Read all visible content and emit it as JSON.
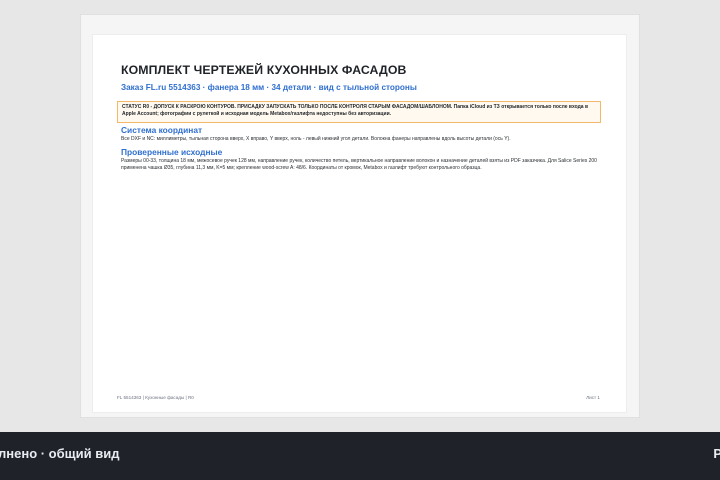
{
  "document": {
    "title": "КОМПЛЕКТ ЧЕРТЕЖЕЙ КУХОННЫХ ФАСАДОВ",
    "subtitle": "Заказ FL.ru 5514363 · фанера 18 мм · 34 детали · вид с тыльной стороны",
    "status_box_text": "СТАТУС R0 - ДОПУСК К РАСКРОЮ КОНТУРОВ. ПРИСАДКУ ЗАПУСКАТЬ ТОЛЬКО ПОСЛЕ КОНТРОЛЯ СТАРЫМ ФАСАДОМ/ШАБЛОНОМ. Папка iCloud из ТЗ открывается только после входа в Apple Account; фотографии с рулеткой и исходная модель Metabox/газлифта недоступны без авторизации.",
    "sections": [
      {
        "heading": "Система координат",
        "text": "Все DXF и NC: миллиметры, тыльная сторона вверх, X вправо, Y вверх, ноль - левый нижний угол детали. Волокна фанеры направлены вдоль высоты детали (ось Y)."
      },
      {
        "heading": "Проверенные исходные",
        "text": "Размеры 00-33, толщина 18 мм, межосевое ручек 128 мм, направление ручек, количество петель, вертикальное направление волокон и назначение деталей взяты из PDF заказчика. Для Salice Series 200 применена чашка Ø35, глубина 11,3 мм, K=5 мм; крепление wood-screw A: 48/6. Координаты от кромок, Metabox и газлифт требуют контрольного образца."
      }
    ],
    "footer_left": "FL 5514363 | Кухонные фасады | R0",
    "footer_right": "Лист 1"
  },
  "bottom_bar": {
    "left_text": "лнено · общий вид",
    "right_text": "Р"
  },
  "colors": {
    "accent_blue": "#2f6fcf",
    "status_border": "#f3b86a",
    "bottom_bar_bg": "#1f2329"
  }
}
